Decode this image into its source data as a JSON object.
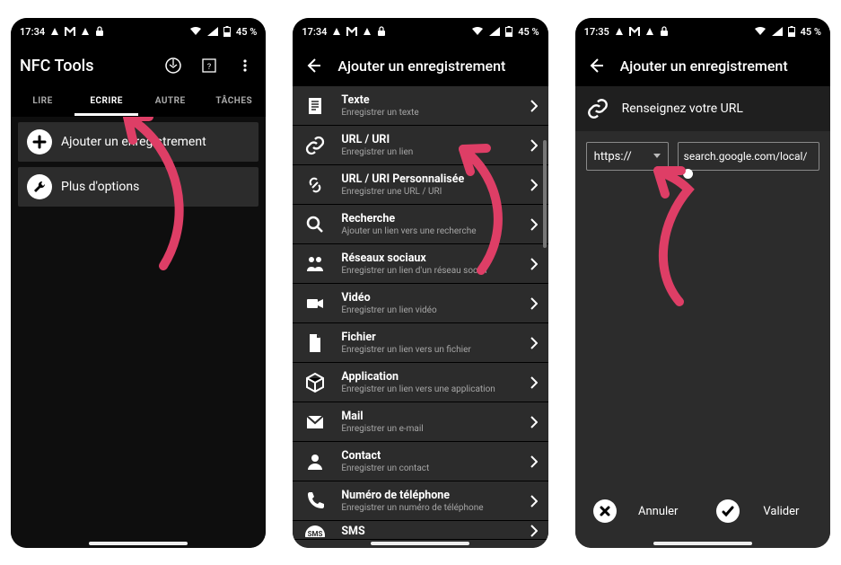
{
  "status": {
    "times": [
      "17:34",
      "17:34",
      "17:35"
    ],
    "battery": "45 %"
  },
  "screen1": {
    "title": "NFC Tools",
    "tabs": [
      "LIRE",
      "ECRIRE",
      "AUTRE",
      "TÂCHES"
    ],
    "active_tab": 1,
    "buttons": {
      "add": "Ajouter un enregistrement",
      "more": "Plus d'options"
    }
  },
  "screen2": {
    "title": "Ajouter un enregistrement",
    "items": [
      {
        "title": "Texte",
        "sub": "Enregistrer un texte",
        "icon": "text"
      },
      {
        "title": "URL / URI",
        "sub": "Enregistrer un lien",
        "icon": "link"
      },
      {
        "title": "URL / URI Personnalisée",
        "sub": "Enregistrer une URL / URI",
        "icon": "link2"
      },
      {
        "title": "Recherche",
        "sub": "Ajouter un lien vers une recherche",
        "icon": "search"
      },
      {
        "title": "Réseaux sociaux",
        "sub": "Enregistrer un lien d'un réseau social",
        "icon": "social"
      },
      {
        "title": "Vidéo",
        "sub": "Enregistrer un lien vidéo",
        "icon": "video"
      },
      {
        "title": "Fichier",
        "sub": "Enregistrer un lien vers un fichier",
        "icon": "file"
      },
      {
        "title": "Application",
        "sub": "Enregistrer un lien vers une application",
        "icon": "app"
      },
      {
        "title": "Mail",
        "sub": "Enregistrer un e-mail",
        "icon": "mail"
      },
      {
        "title": "Contact",
        "sub": "Enregistrer un contact",
        "icon": "contact"
      },
      {
        "title": "Numéro de téléphone",
        "sub": "Enregistrer un numéro de téléphone",
        "icon": "phone"
      },
      {
        "title": "SMS",
        "sub": "",
        "icon": "sms"
      }
    ]
  },
  "screen3": {
    "title": "Ajouter un enregistrement",
    "header": "Renseignez votre URL",
    "scheme": "https://",
    "url": "search.google.com/local/",
    "cancel": "Annuler",
    "ok": "Valider"
  }
}
